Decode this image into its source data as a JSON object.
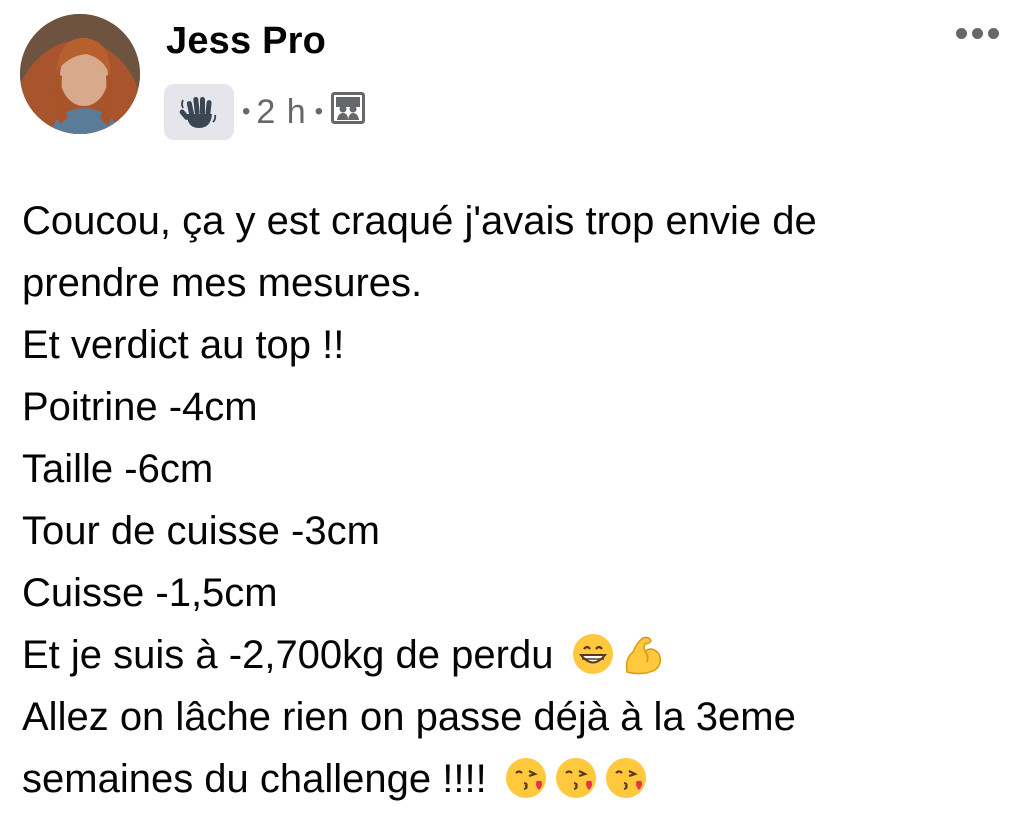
{
  "post": {
    "author_name": "Jess Pro",
    "badge_icon": "wave-hand-icon",
    "separator": "•",
    "time_ago": "2 h",
    "audience_icon": "group-privacy-icon",
    "more_icon": "more-options-icon",
    "lines": [
      "Coucou, ça y est craqué j'avais trop envie de",
      "prendre mes mesures.",
      "Et verdict au top !!",
      "Poitrine -4cm",
      "Taille -6cm",
      "Tour de cuisse -3cm",
      "Cuisse -1,5cm",
      "Et je suis à -2,700kg de perdu",
      "Allez on lâche rien on passe déjà à la 3eme",
      "semaines du challenge !!!!"
    ],
    "emojis": {
      "line_8": [
        "grinning-face-emoji",
        "flexed-biceps-emoji"
      ],
      "line_10": [
        "face-blowing-kiss-emoji",
        "face-blowing-kiss-emoji",
        "face-blowing-kiss-emoji"
      ]
    }
  },
  "colors": {
    "text": "#050505",
    "meta": "#65676b",
    "badge_bg": "#e4e6eb"
  }
}
